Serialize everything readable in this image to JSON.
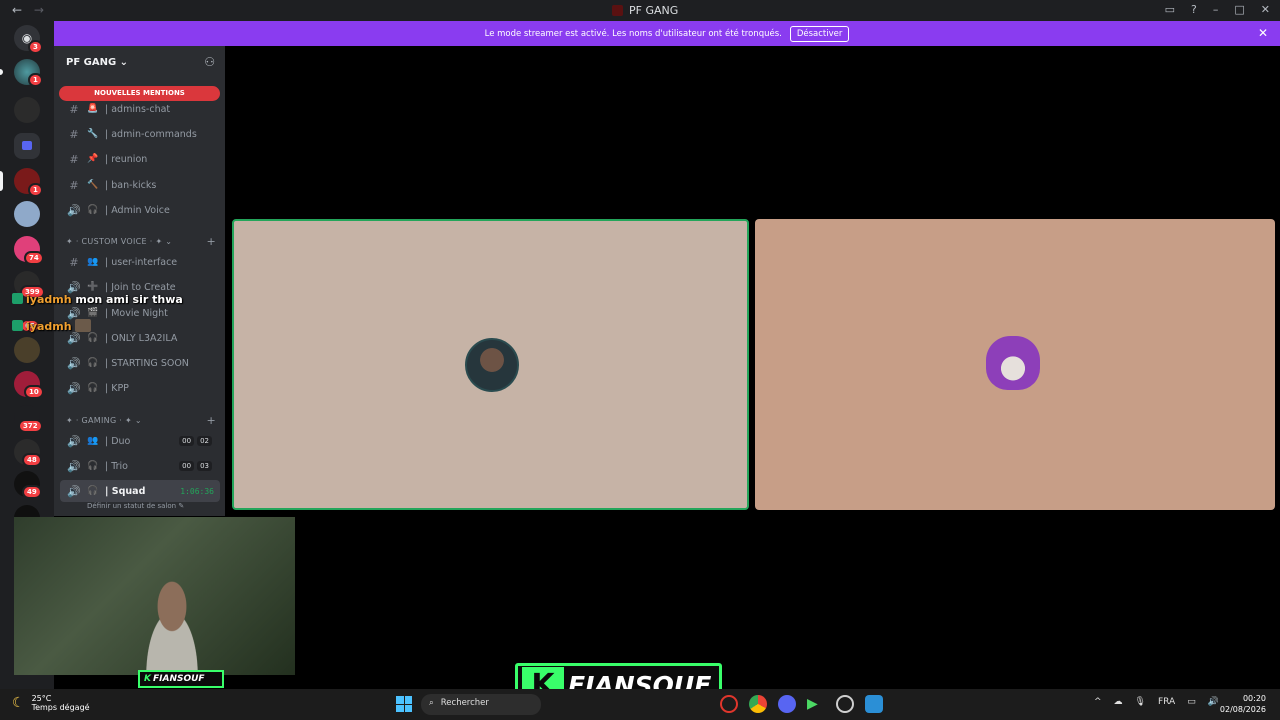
{
  "window": {
    "title": "PF GANG",
    "nav_back": "←",
    "nav_forward": "→"
  },
  "banner": {
    "message": "Le mode streamer est activé. Les noms d'utilisateur ont été tronqués.",
    "button": "Désactiver",
    "close": "✕"
  },
  "rail": {
    "badges": [
      "3",
      "1",
      "1",
      "74",
      "399",
      "65",
      "10",
      "372",
      "48",
      "49"
    ]
  },
  "server": {
    "name": "PF GANG",
    "chevron": "⌄"
  },
  "mentions": "NOUVELLES MENTIONS",
  "channels": [
    {
      "icon": "#",
      "emoji": "🚨",
      "name": "| admins-chat"
    },
    {
      "icon": "#",
      "emoji": "🔧",
      "name": "| admin-commands"
    },
    {
      "icon": "#",
      "emoji": "📌",
      "name": "| reunion"
    },
    {
      "icon": "#",
      "emoji": "🔨",
      "name": "| ban-kicks"
    },
    {
      "icon": "🔊",
      "emoji": "🎧",
      "name": "| Admin Voice"
    }
  ],
  "cat_custom": "✦ · CUSTOM VOICE · ✦ ⌄",
  "custom_channels": [
    {
      "icon": "#",
      "emoji": "👥",
      "name": "| user-interface"
    },
    {
      "icon": "🔊",
      "emoji": "➕",
      "name": "| Join to Create"
    },
    {
      "icon": "🔊",
      "emoji": "🎬",
      "name": "| Movie Night"
    },
    {
      "icon": "🔊",
      "emoji": "🎧",
      "name": "| ONLY L3A2ILA"
    },
    {
      "icon": "🔊",
      "emoji": "🎧",
      "name": "| STARTING SOON"
    },
    {
      "icon": "🔊",
      "emoji": "🎧",
      "name": "| KPP"
    }
  ],
  "cat_gaming": "✦ · GAMING · ✦ ⌄",
  "gaming_channels": [
    {
      "icon": "🔊",
      "emoji": "👥",
      "name": "| Duo",
      "count_a": "00",
      "count_b": "02"
    },
    {
      "icon": "🔊",
      "emoji": "🎧",
      "name": "| Trio",
      "count_a": "00",
      "count_b": "03"
    },
    {
      "icon": "🔊",
      "emoji": "🎧",
      "name": "| Squad",
      "timer": "1:06:36"
    }
  ],
  "status_hint": "Définir un statut de salon ✎",
  "chat": [
    {
      "user": "iyadmh",
      "text": "mon ami sir thwa"
    },
    {
      "user": "iyadmh",
      "text": ""
    }
  ],
  "stream_brand": {
    "k": "K",
    "name": "FIANSOUF"
  },
  "taskbar": {
    "temperature": "25°C",
    "weather": "Temps dégagé",
    "search": "Rechercher",
    "language": "FRA",
    "time": "00:20",
    "date": "02/08/2026"
  },
  "colors": {
    "accent": "#8a3cf0",
    "speaking": "#23a55a",
    "brand_green": "#39ff6a"
  }
}
